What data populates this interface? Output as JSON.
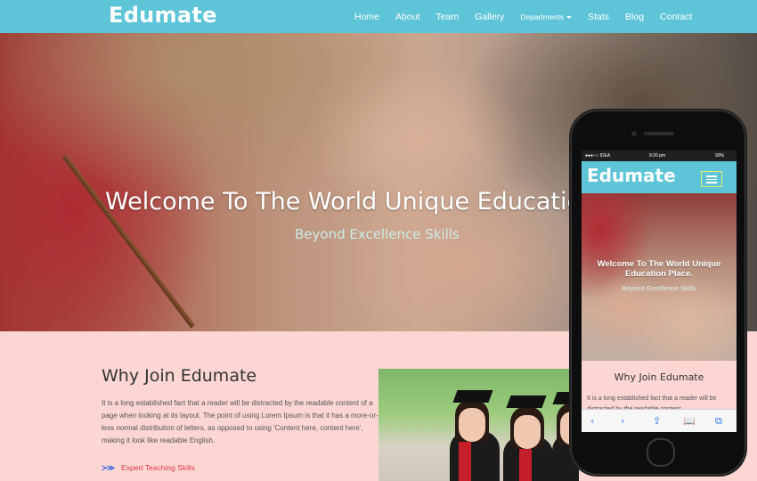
{
  "brand": "Edumate",
  "nav": {
    "items": [
      "Home",
      "About",
      "Team",
      "Gallery",
      "Departments",
      "Stats",
      "Blog",
      "Contact"
    ]
  },
  "hero": {
    "title": "Welcome To The World Unique Education",
    "subtitle": "Beyond Excellence Skills"
  },
  "why": {
    "title": "Why Join Edumate",
    "text": "It is a long established fact that a reader will be distracted by the readable content of a page when looking at its layout. The point of using Lorem Ipsum is that it has a more-or-less normal distribution of letters, as opposed to using 'Content here, content here', making it look like readable English.",
    "feature_arrows": "≻≫",
    "feature_label": "Expert Teaching Skills"
  },
  "mobile": {
    "status": {
      "carrier": "●●●○○ IDEA",
      "time": "9:20 pm",
      "battery": "90%"
    },
    "brand": "Edumate",
    "hero_title": "Welcome To The World Unique Education Place.",
    "hero_subtitle": "Beyond Excellence Skills",
    "why_title": "Why Join Edumate",
    "why_text": "It is a long established fact that a reader will be distracted by the readable content",
    "toolbar": {
      "back": "‹",
      "forward": "›",
      "share": "⇪",
      "bookmarks": "📖",
      "tabs": "⧉"
    }
  },
  "colors": {
    "navbar": "#5ec4d8",
    "page_bg": "#fbd6d3",
    "feature_text": "#e0384b",
    "hero_subtitle": "#c9ece8"
  }
}
